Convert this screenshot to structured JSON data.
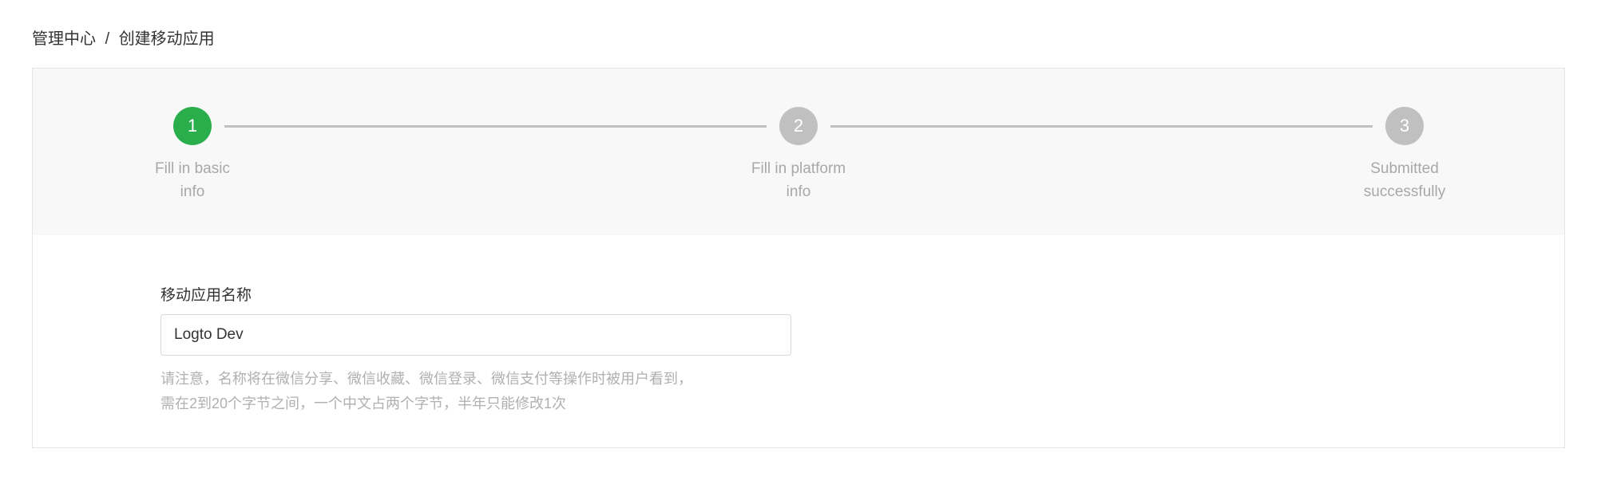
{
  "breadcrumb": {
    "root": "管理中心",
    "separator": "/",
    "current": "创建移动应用"
  },
  "stepper": {
    "steps": [
      {
        "number": "1",
        "label_line1": "Fill in basic",
        "label_line2": "info",
        "active": true
      },
      {
        "number": "2",
        "label_line1": "Fill in platform",
        "label_line2": "info",
        "active": false
      },
      {
        "number": "3",
        "label_line1": "Submitted",
        "label_line2": "successfully",
        "active": false
      }
    ]
  },
  "form": {
    "app_name": {
      "label": "移动应用名称",
      "value": "Logto Dev",
      "help_line1": "请注意，名称将在微信分享、微信收藏、微信登录、微信支付等操作时被用户看到，",
      "help_line2": "需在2到20个字节之间，一个中文占两个字节，半年只能修改1次"
    }
  },
  "colors": {
    "accent_green": "#2aae4c",
    "inactive_gray": "#c0c0c0"
  }
}
